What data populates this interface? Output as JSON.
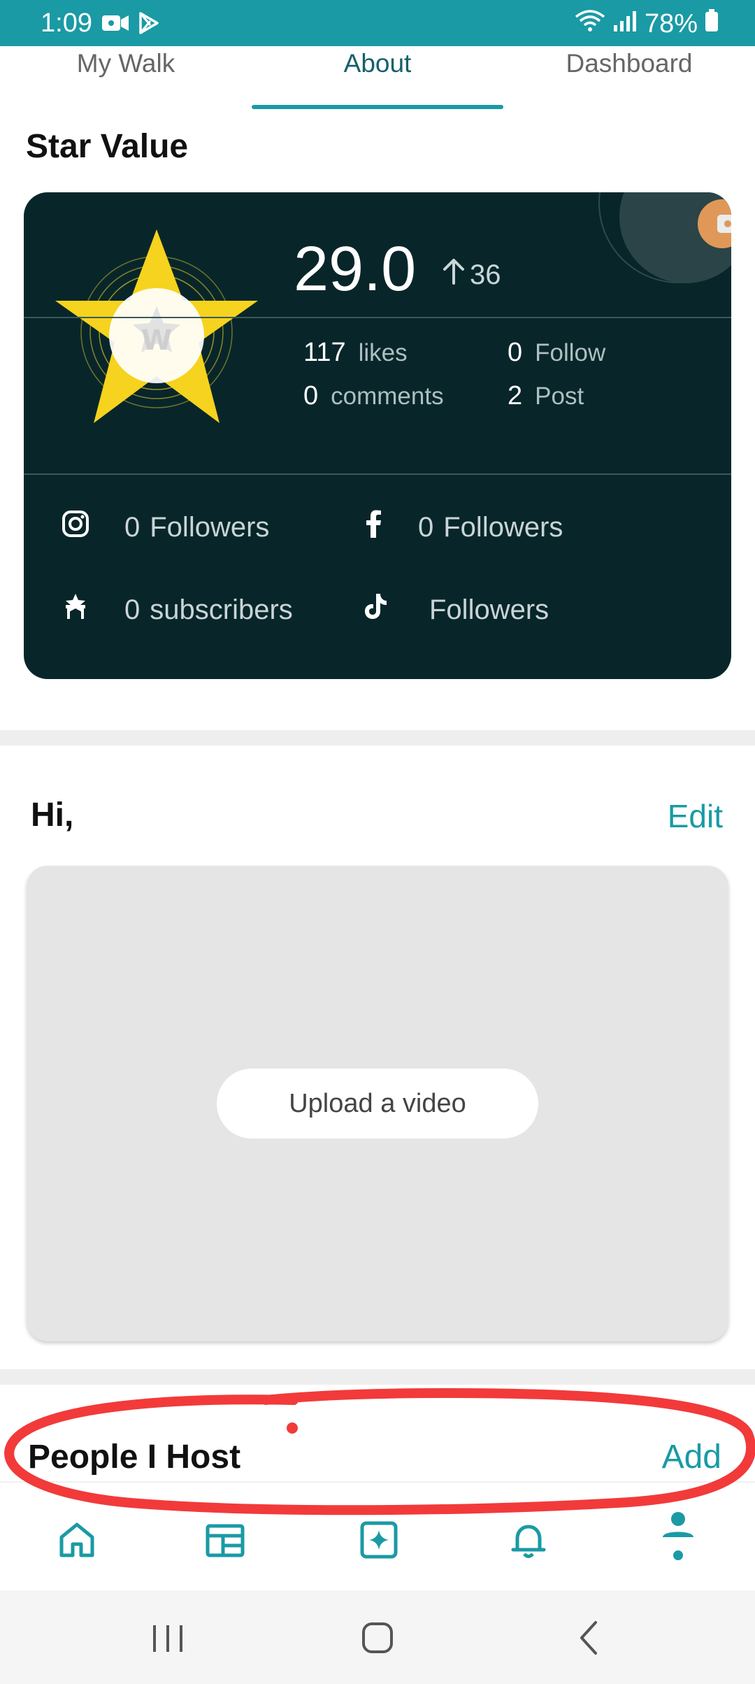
{
  "status_bar": {
    "time": "1:09",
    "battery": "78%"
  },
  "tabs": [
    {
      "label": "My Walk"
    },
    {
      "label": "About"
    },
    {
      "label": "Dashboard"
    }
  ],
  "star_value": {
    "title": "Star Value",
    "value": "29.0",
    "trend": "36",
    "logo_text": "Walkabout",
    "stats": {
      "likes": {
        "num": "117",
        "label": "likes"
      },
      "follow": {
        "num": "0",
        "label": "Follow"
      },
      "comments": {
        "num": "0",
        "label": "comments"
      },
      "post": {
        "num": "2",
        "label": "Post"
      }
    },
    "social": {
      "instagram": {
        "num": "0",
        "label": "Followers"
      },
      "facebook": {
        "num": "0",
        "label": "Followers"
      },
      "walkabout": {
        "num": "0",
        "label": "subscribers"
      },
      "tiktok": {
        "label": "Followers"
      }
    }
  },
  "profile": {
    "greeting": "Hi,",
    "edit_label": "Edit",
    "upload_label": "Upload a video"
  },
  "host": {
    "title": "People I Host",
    "add_label": "Add"
  },
  "colors": {
    "accent": "#1a9aa5",
    "card_bg": "#08262a",
    "star": "#f5d31e",
    "annotation": "#f23a3a"
  }
}
